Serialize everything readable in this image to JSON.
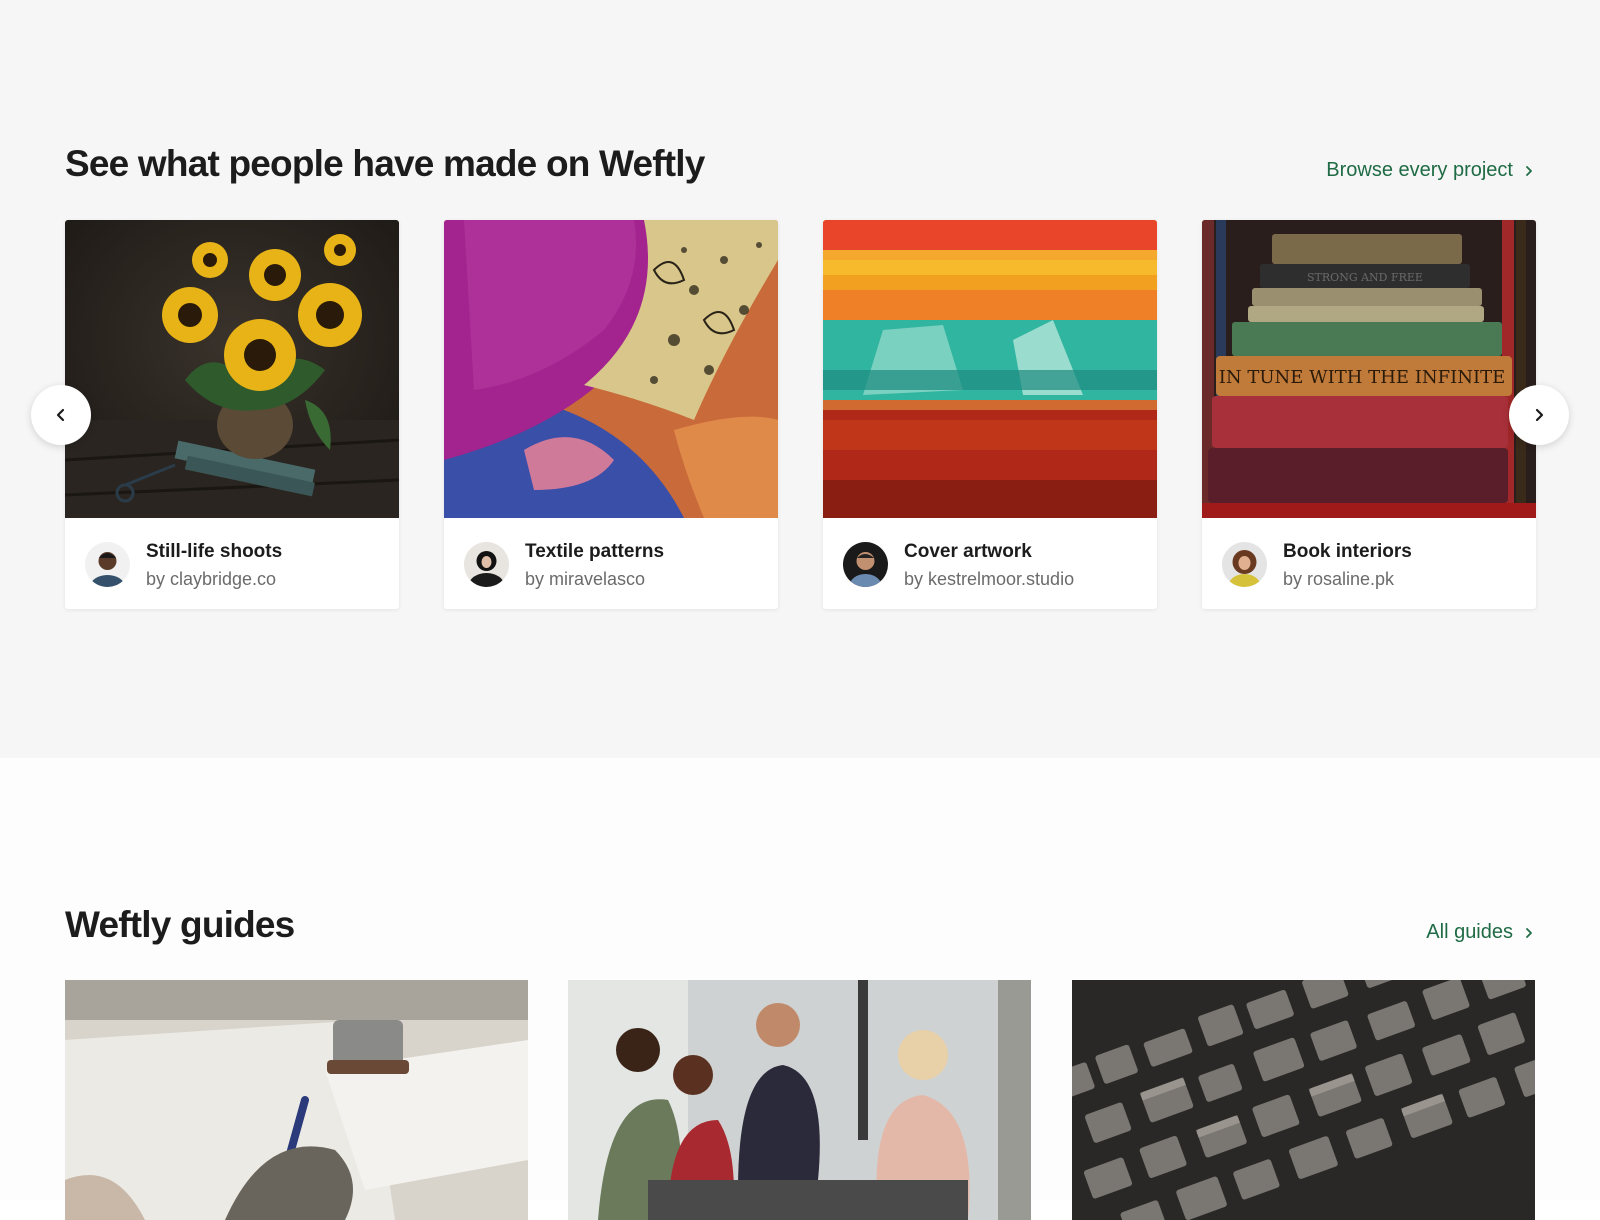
{
  "showcase": {
    "title": "See what people have made on Weftly",
    "see_all": "Browse every project",
    "prev_icon": "chevron-left-icon",
    "next_icon": "chevron-right-icon",
    "cards": [
      {
        "title": "Still-life shoots",
        "by": "by claybridge.co",
        "image": "sunflowers-photo"
      },
      {
        "title": "Textile patterns",
        "by": "by miravelasco",
        "image": "fabric-photo"
      },
      {
        "title": "Cover artwork",
        "by": "by kestrelmoor.studio",
        "image": "abstract-painting-photo"
      },
      {
        "title": "Book interiors",
        "by": "by rosaline.pk",
        "image": "book-stack-photo",
        "spine_text_1": "IN TUNE WITH THE INFINITE",
        "spine_text_2": "STRONG AND FREE"
      }
    ]
  },
  "guides": {
    "title": "Weftly guides",
    "see_all": "All guides",
    "cards": [
      {
        "image": "writing-notes-photo"
      },
      {
        "image": "team-meeting-photo"
      },
      {
        "image": "letterpress-type-photo"
      }
    ]
  },
  "colors": {
    "accent": "#1f6b45",
    "showcase_bg": "#f6f6f6",
    "text": "#1c1c1c",
    "muted": "#6b6b6b"
  }
}
